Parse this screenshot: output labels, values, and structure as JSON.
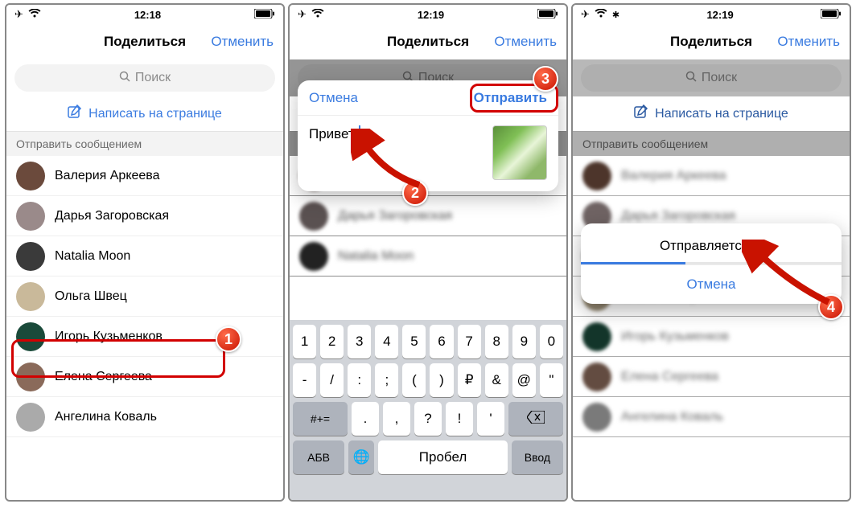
{
  "statusbar": {
    "time_p1": "12:18",
    "time_p2": "12:19",
    "time_p3": "12:19"
  },
  "navbar": {
    "title": "Поделиться",
    "cancel": "Отменить"
  },
  "search": {
    "placeholder": "Поиск"
  },
  "write_on_wall": "Написать на странице",
  "section_header": "Отправить сообщением",
  "contacts": [
    {
      "name": "Валерия Аркеева"
    },
    {
      "name": "Дарья Загоровская"
    },
    {
      "name": "Natalia Moon"
    },
    {
      "name": "Ольга Швец"
    },
    {
      "name": "Игорь Кузьменков"
    },
    {
      "name": "Елена Сергеева"
    },
    {
      "name": "Ангелина Коваль"
    }
  ],
  "compose": {
    "cancel": "Отмена",
    "send": "Отправить",
    "message": "Привет!"
  },
  "keyboard": {
    "row1": [
      "1",
      "2",
      "3",
      "4",
      "5",
      "6",
      "7",
      "8",
      "9",
      "0"
    ],
    "row2": [
      "-",
      "/",
      ":",
      ";",
      "(",
      ")",
      "₽",
      "&",
      "@",
      "\""
    ],
    "row3_switch": "#+=",
    "row3_keys": [
      ".",
      ",",
      "?",
      "!",
      "'"
    ],
    "abc": "АБВ",
    "space": "Пробел",
    "enter": "Ввод"
  },
  "sending": {
    "title": "Отправляется…",
    "cancel": "Отмена"
  },
  "steps": {
    "s1": "1",
    "s2": "2",
    "s3": "3",
    "s4": "4"
  }
}
